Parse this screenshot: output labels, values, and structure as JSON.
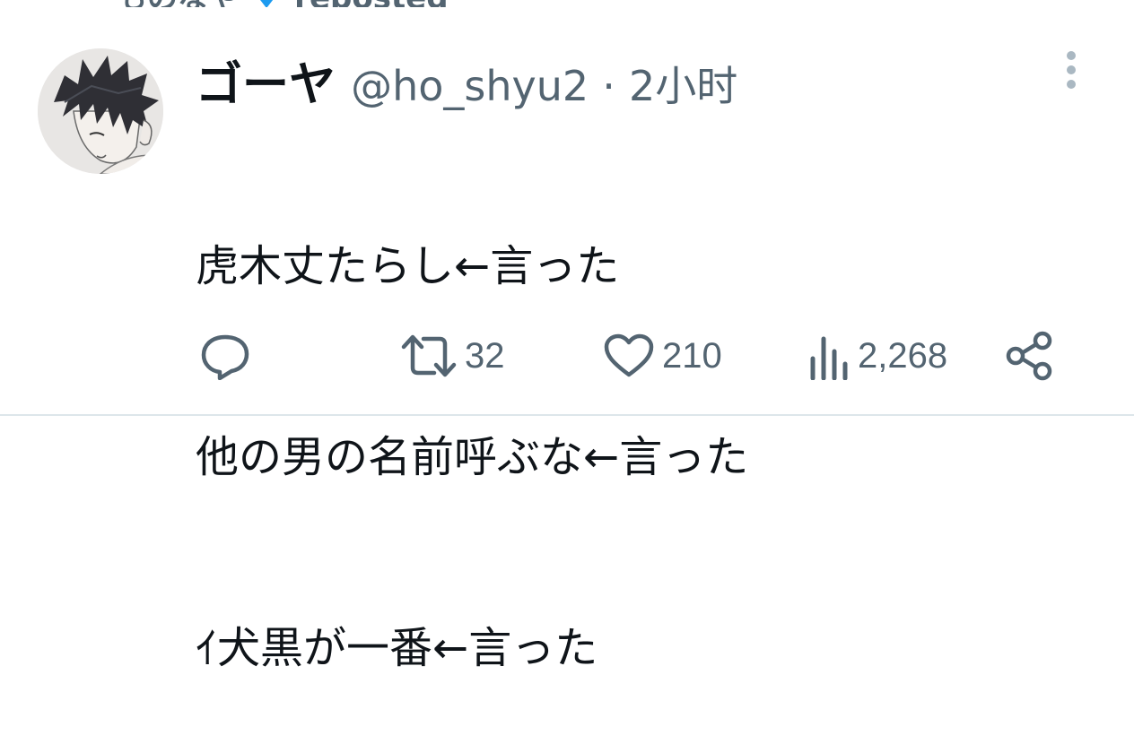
{
  "repost_banner": {
    "text_left": "ものなや",
    "text_right": "reposted"
  },
  "tweet": {
    "display_name": "ゴーヤ",
    "handle": "@ho_shyu2",
    "separator": "·",
    "time": "2小时",
    "lines": [
      "虎木丈たらし←言った",
      "他の男の名前呼ぶな←言った",
      "ｲ犬黒が一番←言った"
    ]
  },
  "actions": {
    "reply": {
      "icon": "reply-icon",
      "count": ""
    },
    "retweet": {
      "icon": "retweet-icon",
      "count": "32"
    },
    "like": {
      "icon": "heart-icon",
      "count": "210"
    },
    "views": {
      "icon": "views-icon",
      "count": "2,268"
    },
    "share": {
      "icon": "share-icon"
    }
  },
  "colors": {
    "text": "#0f1419",
    "secondary": "#536471",
    "divider": "#dde6ea",
    "accent": "#1d9bf0"
  }
}
